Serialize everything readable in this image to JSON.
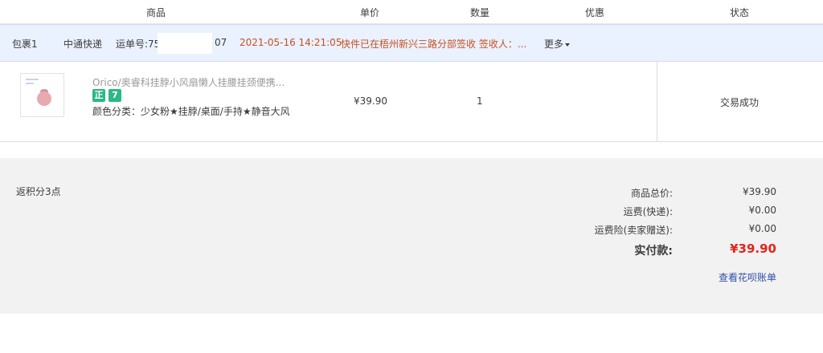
{
  "headers": {
    "product": "商品",
    "unit_price": "单价",
    "quantity": "数量",
    "discount": "优惠",
    "status": "状态"
  },
  "package": {
    "name": "包裹1",
    "carrier": "中通快递",
    "tracking_label": "运单号:75",
    "tracking_suffix": "07",
    "timestamp": "2021-05-16 14:21:05",
    "message": "快件已在梧州新兴三路分部签收 签收人：...",
    "more": "更多"
  },
  "item": {
    "title": "Orico/奥睿科挂脖小风扇懒人挂腰挂颈便携...",
    "badge_genuine": "正",
    "badge_seven": "7",
    "spec": "颜色分类：少女粉★挂脖/桌面/手持★静音大风",
    "price": "¥39.90",
    "quantity": "1",
    "status": "交易成功"
  },
  "summary": {
    "points": "返积分3点",
    "goods_total_label": "商品总价:",
    "goods_total": "¥39.90",
    "shipping_label": "运费(快递):",
    "shipping": "¥0.00",
    "insurance_label": "运费险(卖家赠送):",
    "insurance": "¥0.00",
    "paid_label": "实付款:",
    "paid": "¥39.90",
    "huabei_link": "查看花呗账单"
  },
  "colors": {
    "accent_orange": "#c8501e",
    "price_red": "#e4231e",
    "link_blue": "#2f4fa8",
    "badge_green": "#2bb886",
    "package_bar_bg": "#eaf1ff"
  },
  "icons": {
    "more": "chevron-down-icon",
    "thumbnail": "product-thumbnail"
  }
}
